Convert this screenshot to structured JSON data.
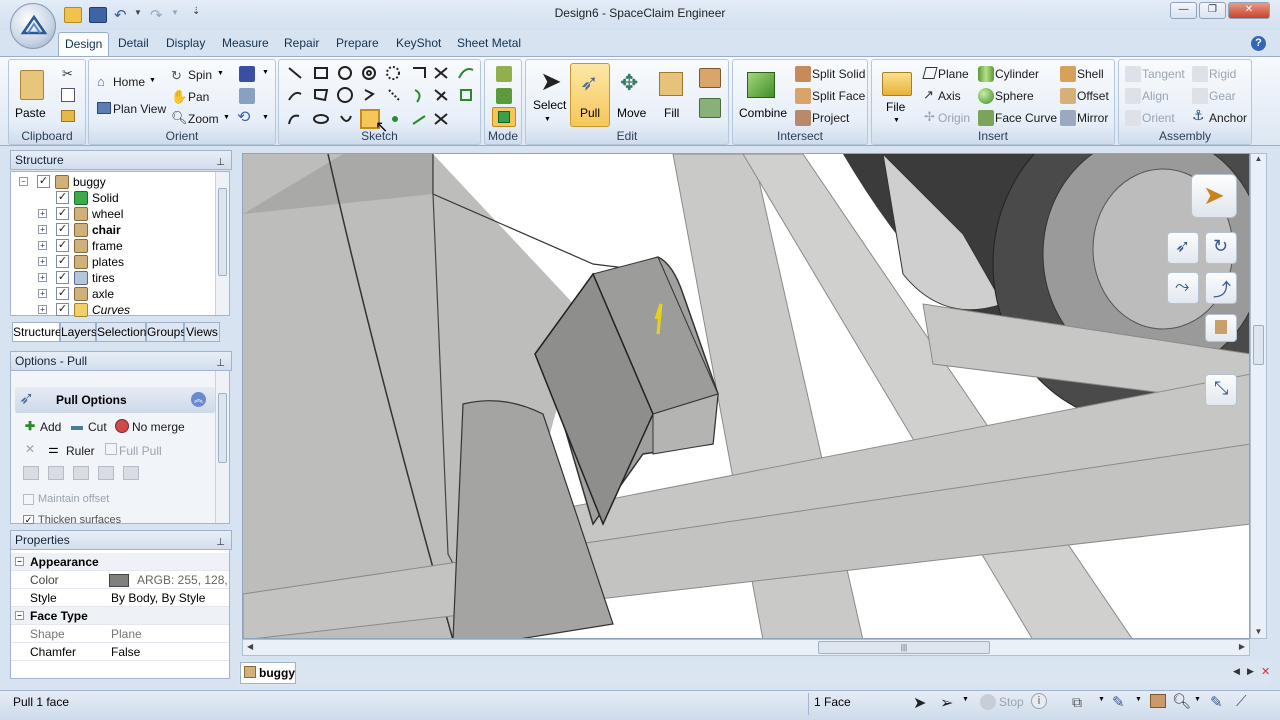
{
  "window": {
    "title": "Design6 - SpaceClaim Engineer"
  },
  "tabs": [
    "Design",
    "Detail",
    "Display",
    "Measure",
    "Repair",
    "Prepare",
    "KeyShot",
    "Sheet Metal"
  ],
  "ribbon": {
    "clipboard": {
      "label": "Clipboard",
      "paste": "Paste"
    },
    "orient": {
      "label": "Orient",
      "home": "Home",
      "plan_view": "Plan View",
      "spin": "Spin",
      "pan": "Pan",
      "zoom": "Zoom"
    },
    "sketch": {
      "label": "Sketch"
    },
    "mode": {
      "label": "Mode"
    },
    "edit": {
      "label": "Edit",
      "select": "Select",
      "pull": "Pull",
      "move": "Move",
      "fill": "Fill"
    },
    "intersect": {
      "label": "Intersect",
      "combine": "Combine",
      "split_solid": "Split Solid",
      "split_face": "Split Face",
      "project": "Project"
    },
    "insert": {
      "label": "Insert",
      "file": "File",
      "plane": "Plane",
      "axis": "Axis",
      "origin": "Origin",
      "cylinder": "Cylinder",
      "sphere": "Sphere",
      "face_curve": "Face Curve",
      "shell": "Shell",
      "offset": "Offset",
      "mirror": "Mirror"
    },
    "assembly": {
      "label": "Assembly",
      "tangent": "Tangent",
      "align": "Align",
      "orient": "Orient",
      "rigid": "Rigid",
      "gear": "Gear",
      "anchor": "Anchor"
    }
  },
  "structure": {
    "title": "Structure",
    "items": [
      {
        "label": "buggy"
      },
      {
        "label": "Solid"
      },
      {
        "label": "wheel"
      },
      {
        "label": "chair"
      },
      {
        "label": "frame"
      },
      {
        "label": "plates"
      },
      {
        "label": "tires"
      },
      {
        "label": "axle"
      },
      {
        "label": "Curves"
      }
    ],
    "tabs": [
      "Structure",
      "Layers",
      "Selection",
      "Groups",
      "Views"
    ]
  },
  "options": {
    "title": "Options - Pull",
    "heading": "Pull Options",
    "add": "Add",
    "cut": "Cut",
    "no_merge": "No merge",
    "ruler": "Ruler",
    "full_pull": "Full Pull",
    "maintain_offset": "Maintain offset",
    "thicken_surfaces": "Thicken surfaces"
  },
  "properties": {
    "title": "Properties",
    "appearance": "Appearance",
    "color_label": "Color",
    "color_value": "ARGB: 255, 128,",
    "style_label": "Style",
    "style_value": "By Body, By Style",
    "face_type": "Face Type",
    "shape_label": "Shape",
    "shape_value": "Plane",
    "chamfer_label": "Chamfer",
    "chamfer_value": "False"
  },
  "document_tab": "buggy",
  "status": {
    "left": "Pull 1 face",
    "selection": "1 Face",
    "stop": "Stop"
  },
  "colors": {
    "accent": "#f5c75b",
    "ribbon_border": "#98aeca",
    "body_grey": "#c6c6c4"
  }
}
